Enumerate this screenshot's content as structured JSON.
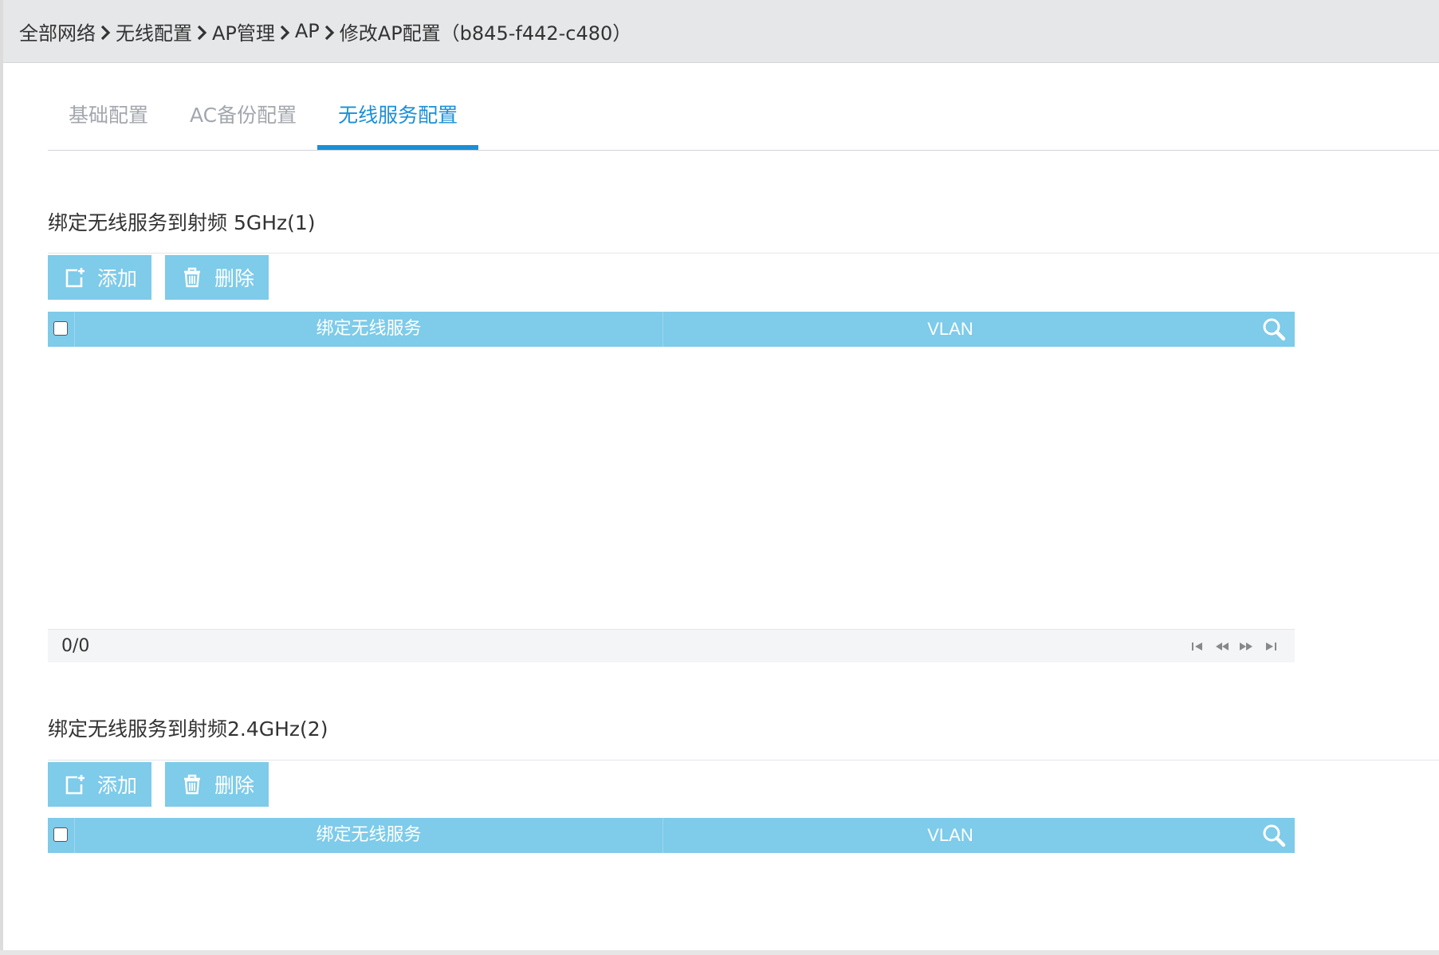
{
  "breadcrumb": [
    "全部网络",
    "无线配置",
    "AP管理",
    "AP",
    "修改AP配置（b845-f442-c480）"
  ],
  "tabs": [
    {
      "label": "基础配置",
      "active": false
    },
    {
      "label": "AC备份配置",
      "active": false
    },
    {
      "label": "无线服务配置",
      "active": true
    }
  ],
  "sections": [
    {
      "title": "绑定无线服务到射频 5GHz(1)",
      "add_label": "添加",
      "delete_label": "删除",
      "columns": [
        "绑定无线服务",
        "VLAN"
      ],
      "rows": [],
      "pager_count": "0/0"
    },
    {
      "title": "绑定无线服务到射频2.4GHz(2)",
      "add_label": "添加",
      "delete_label": "删除",
      "columns": [
        "绑定无线服务",
        "VLAN"
      ],
      "rows": []
    }
  ],
  "icons": {
    "breadcrumb_separator": "chevron-right-icon",
    "add": "add-icon",
    "delete": "trash-icon",
    "search": "search-icon",
    "pager": [
      "first-page-icon",
      "prev-page-icon",
      "next-page-icon",
      "last-page-icon"
    ]
  },
  "colors": {
    "accent": "#1a8fd6",
    "table_header": "#7ecbea",
    "button": "#7ecbea",
    "topbar": "#e6e7e9",
    "tab_inactive": "#a3a7ad"
  }
}
